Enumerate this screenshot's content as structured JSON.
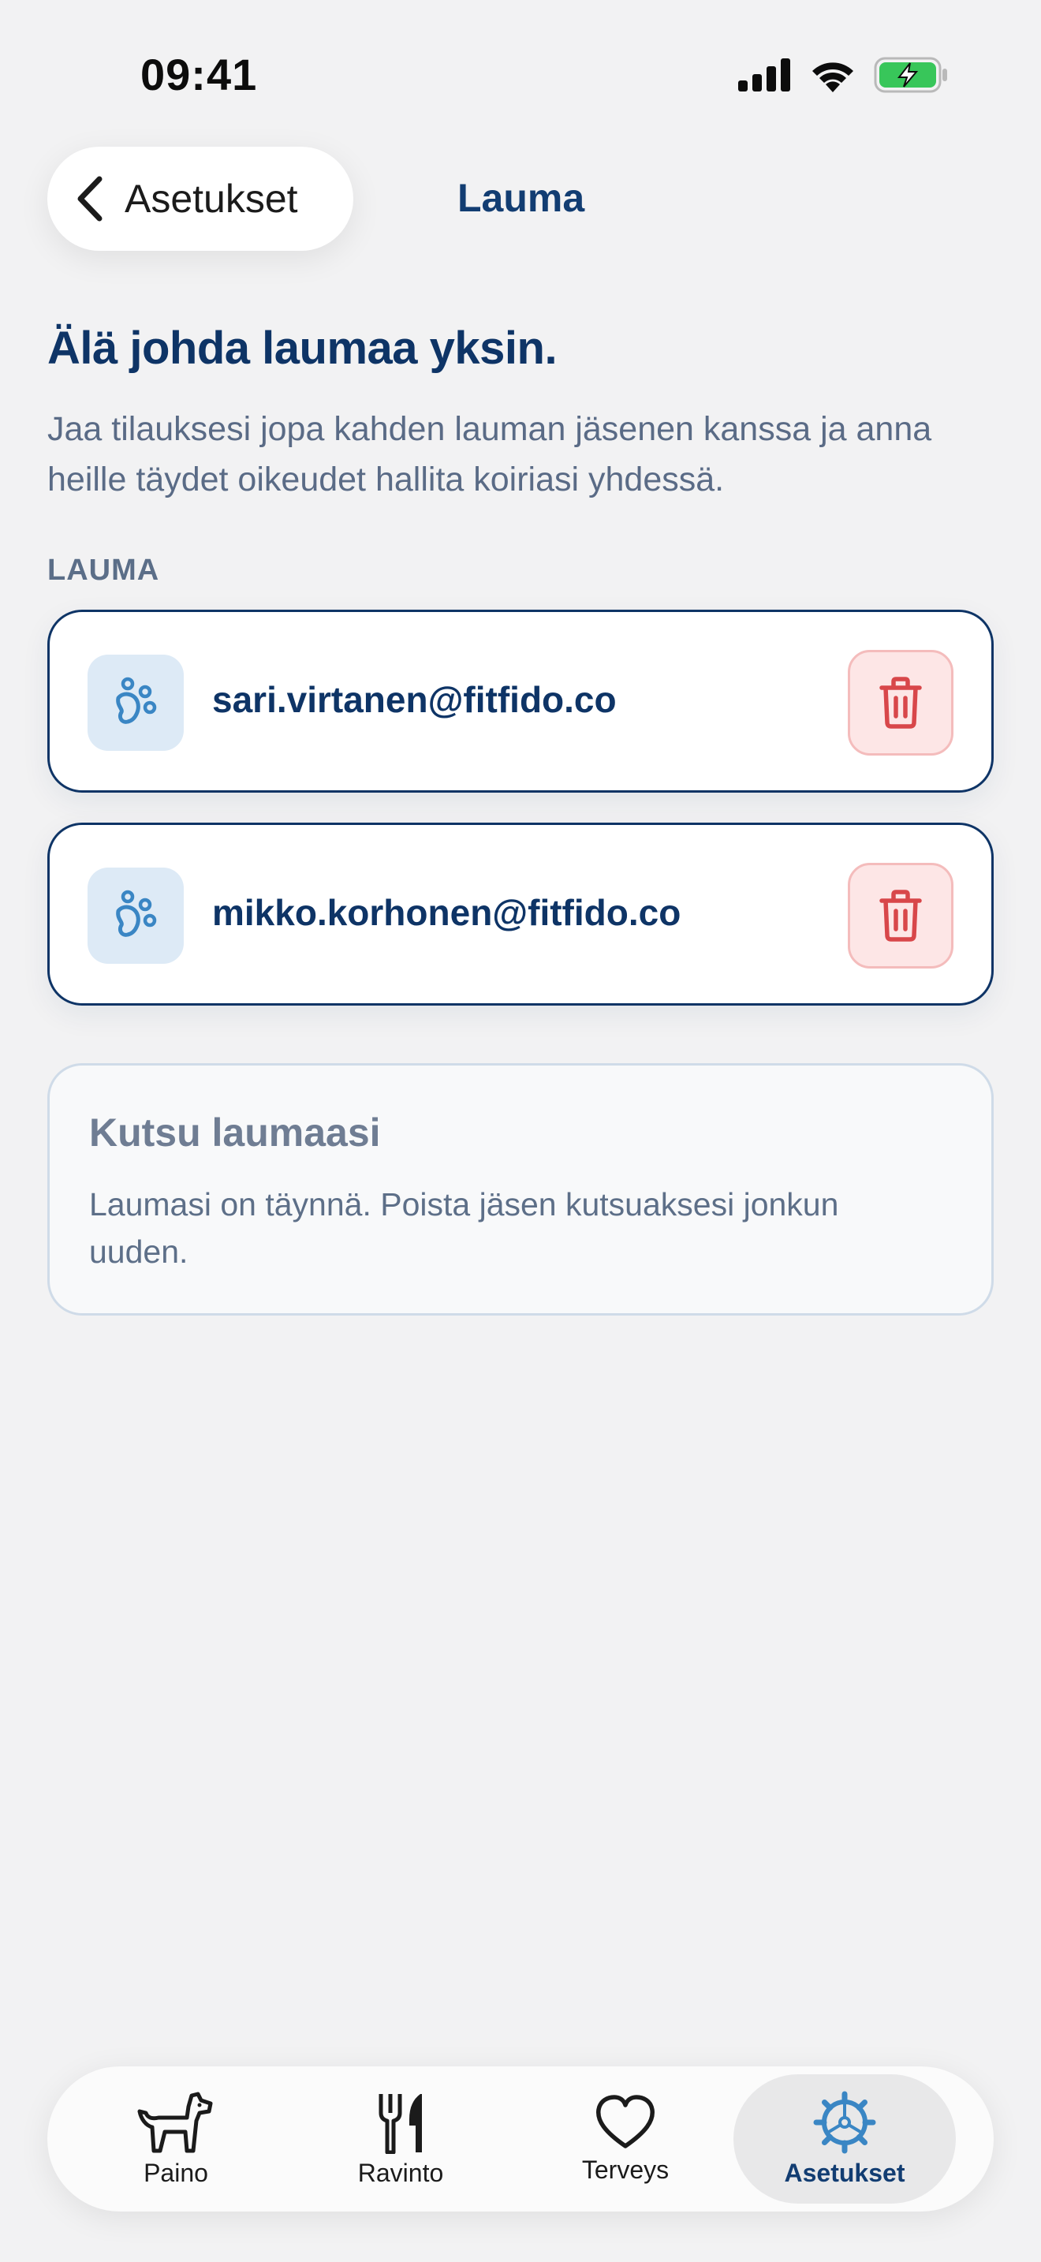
{
  "status_bar": {
    "time": "09:41"
  },
  "nav": {
    "back_label": "Asetukset",
    "title": "Lauma"
  },
  "hero": {
    "title": "Älä johda laumaa yksin.",
    "description": "Jaa tilauksesi jopa kahden lauman jäsenen kanssa ja anna heille täydet oikeudet hallita koiriasi yhdessä."
  },
  "section_label": "LAUMA",
  "members": [
    {
      "email": "sari.virtanen@fitfido.co",
      "avatar_icon": "paw-icon",
      "delete_icon": "trash-icon"
    },
    {
      "email": "mikko.korhonen@fitfido.co",
      "avatar_icon": "paw-icon",
      "delete_icon": "trash-icon"
    }
  ],
  "invite": {
    "title": "Kutsu laumaasi",
    "description": "Laumasi on täynnä. Poista jäsen kutsuaksesi jonkun uuden."
  },
  "tabs": [
    {
      "label": "Paino",
      "icon": "dog-icon",
      "active": false
    },
    {
      "label": "Ravinto",
      "icon": "fork-knife-icon",
      "active": false
    },
    {
      "label": "Terveys",
      "icon": "heart-icon",
      "active": false
    },
    {
      "label": "Asetukset",
      "icon": "gear-icon",
      "active": true
    }
  ],
  "colors": {
    "primary": "#0e3466",
    "accent": "#3a86c4",
    "danger": "#d8474a",
    "background": "#f2f2f3"
  }
}
